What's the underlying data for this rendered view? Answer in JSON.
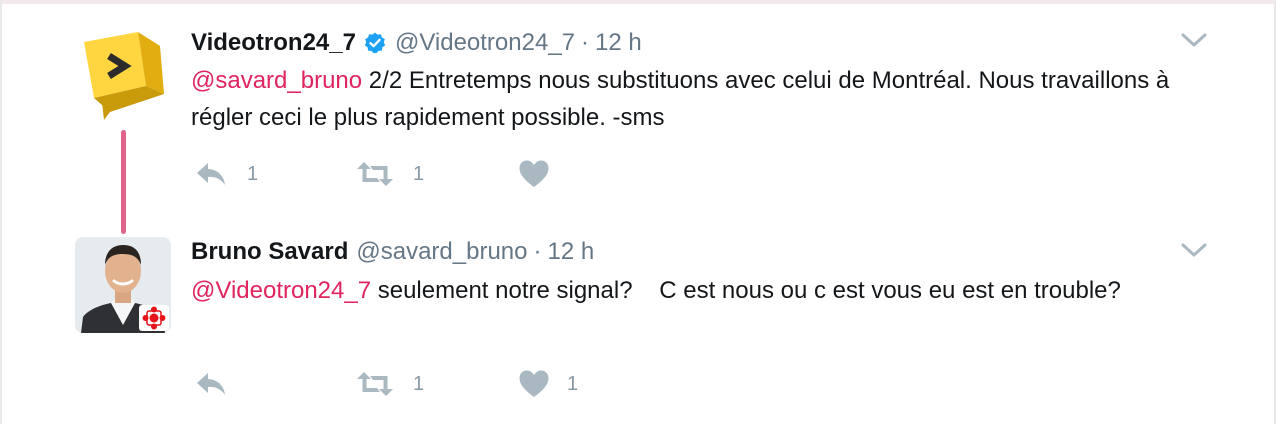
{
  "tweets": [
    {
      "name": "Videotron24_7",
      "verified": true,
      "handle": "@Videotron24_7",
      "separator": "·",
      "time": "12 h",
      "mention": "@savard_bruno",
      "body": " 2/2 Entretemps nous substituons avec celui de Montréal. Nous travaillons à régler ceci le plus rapidement possible. -sms",
      "reply_count": "1",
      "retweet_count": "1",
      "like_count": ""
    },
    {
      "name": "Bruno Savard",
      "verified": false,
      "handle": "@savard_bruno",
      "separator": "·",
      "time": "12 h",
      "mention": "@Videotron24_7",
      "body": " seulement notre signal?    C est nous ou c est vous eu est en trouble?",
      "reply_count": "",
      "retweet_count": "1",
      "like_count": "1"
    }
  ],
  "colors": {
    "mention": "#e0245e",
    "meta": "#657786",
    "action_icon": "#aab8c2",
    "thread_line": "#e0648a",
    "verified": "#1da1f2"
  },
  "icons": [
    "videotron-logo-icon",
    "verified-badge-icon",
    "chevron-down-icon",
    "reply-icon",
    "retweet-icon",
    "like-heart-icon",
    "cbc-logo-icon"
  ]
}
